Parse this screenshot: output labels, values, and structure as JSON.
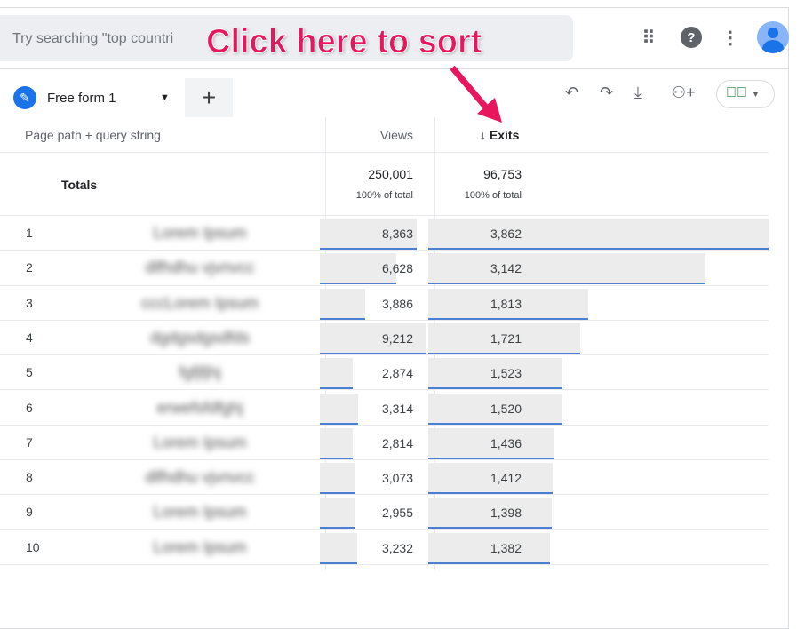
{
  "search": {
    "placeholder": "Try searching \"top countri"
  },
  "annotation": {
    "text": "Click here to sort",
    "color": "#e8175d"
  },
  "topbar": {
    "icons": [
      "apps-icon",
      "help-icon",
      "more-vert-icon",
      "avatar"
    ]
  },
  "tab": {
    "label": "Free form 1",
    "add_label": "+"
  },
  "toolbar": {
    "icons": [
      "undo-icon",
      "redo-icon",
      "download-icon",
      "share-icon",
      "check-circle-icon"
    ]
  },
  "table": {
    "headers": {
      "dimension": "Page path + query string",
      "views": "Views",
      "exits": "↓ Exits"
    },
    "totals": {
      "label": "Totals",
      "views": "250,001",
      "views_pct": "100% of total",
      "exits": "96,753",
      "exits_pct": "100% of total"
    },
    "rows": [
      {
        "rank": "1",
        "path": "Lorem Ipsum",
        "views": "8,363",
        "exits": "3,862",
        "v": 8363,
        "e": 3862
      },
      {
        "rank": "2",
        "path": "dlfhdhu vjvnvcc",
        "views": "6,628",
        "exits": "3,142",
        "v": 6628,
        "e": 3142
      },
      {
        "rank": "3",
        "path": "cccLorem Ipsum",
        "views": "3,886",
        "exits": "1,813",
        "v": 3886,
        "e": 1813
      },
      {
        "rank": "4",
        "path": "dgdgsdgsdfds",
        "views": "9,212",
        "exits": "1,721",
        "v": 9212,
        "e": 1721
      },
      {
        "rank": "5",
        "path": "fgfjfjhj",
        "views": "2,874",
        "exits": "1,523",
        "v": 2874,
        "e": 1523
      },
      {
        "rank": "6",
        "path": "erwefsfdfghj",
        "views": "3,314",
        "exits": "1,520",
        "v": 3314,
        "e": 1520
      },
      {
        "rank": "7",
        "path": "Lorem Ipsum",
        "views": "2,814",
        "exits": "1,436",
        "v": 2814,
        "e": 1436
      },
      {
        "rank": "8",
        "path": "dlfhdhu vjvnvcc",
        "views": "3,073",
        "exits": "1,412",
        "v": 3073,
        "e": 1412
      },
      {
        "rank": "9",
        "path": "Lorem Ipsum",
        "views": "2,955",
        "exits": "1,398",
        "v": 2955,
        "e": 1398
      },
      {
        "rank": "10",
        "path": "Lorem Ipsum",
        "views": "3,232",
        "exits": "1,382",
        "v": 3232,
        "e": 1382
      }
    ]
  }
}
